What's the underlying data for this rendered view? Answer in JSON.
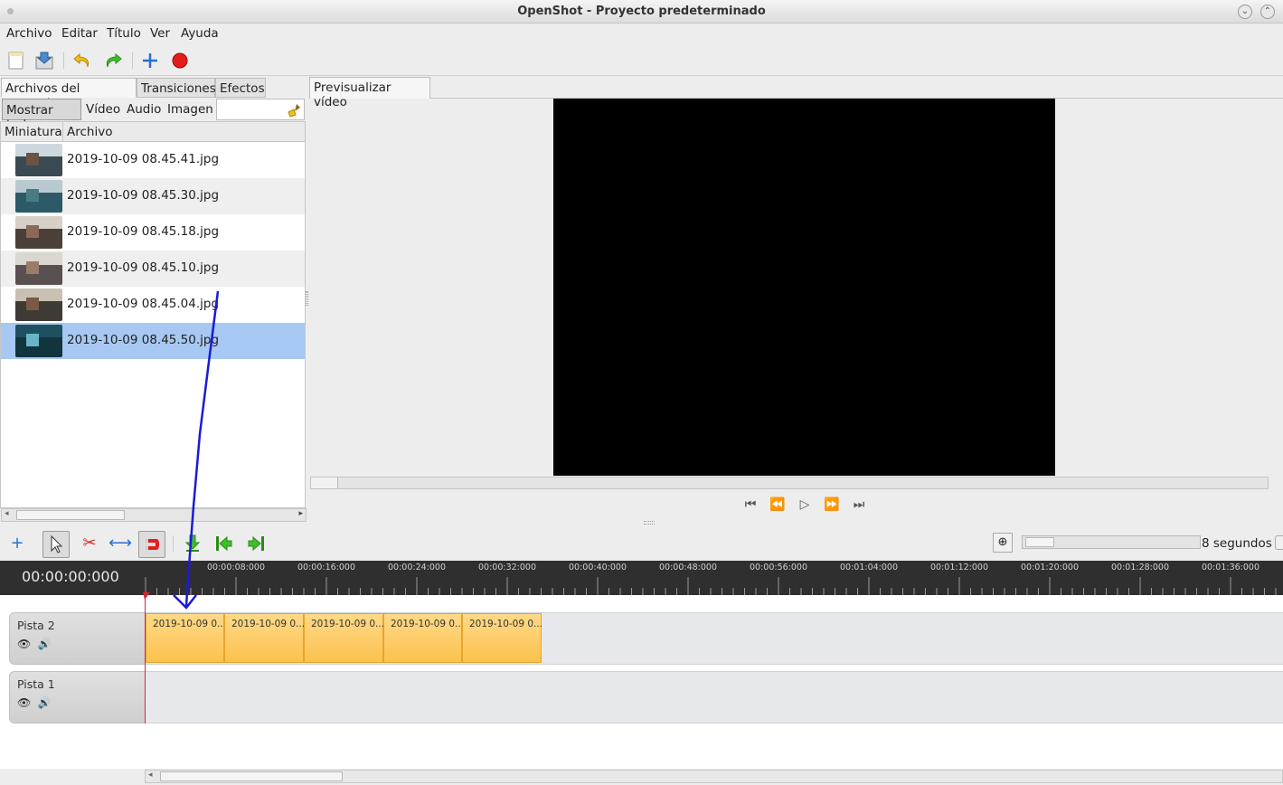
{
  "window": {
    "title": "OpenShot - Proyecto predeterminado"
  },
  "menu": [
    "Archivo",
    "Editar",
    "Título",
    "Ver",
    "Ayuda"
  ],
  "left_tabs": [
    "Archivos del proyecto",
    "Transiciones",
    "Efectos"
  ],
  "filters": [
    "Mostrar todo",
    "Vídeo",
    "Audio",
    "Imagen"
  ],
  "file_columns": [
    "Miniatura",
    "Archivo"
  ],
  "files": [
    "2019-10-09 08.45.41.jpg",
    "2019-10-09 08.45.30.jpg",
    "2019-10-09 08.45.18.jpg",
    "2019-10-09 08.45.10.jpg",
    "2019-10-09 08.45.04.jpg",
    "2019-10-09 08.45.50.jpg"
  ],
  "selected_file_index": 5,
  "preview": {
    "tab": "Previsualizar vídeo"
  },
  "timeline": {
    "zoom_label": "8 segundos",
    "timecode": "00:00:00:000",
    "ruler_labels": [
      "00:00:08:000",
      "00:00:16:000",
      "00:00:24:000",
      "00:00:32:000",
      "00:00:40:000",
      "00:00:48:000",
      "00:00:56:000",
      "00:01:04:000",
      "00:01:12:000",
      "00:01:20:000",
      "00:01:28:000",
      "00:01:36:000"
    ],
    "tracks": [
      {
        "name": "Pista 2",
        "clips": [
          "2019-10-09 0...",
          "2019-10-09 0...",
          "2019-10-09 0...",
          "2019-10-09 0...",
          "2019-10-09 0..."
        ]
      },
      {
        "name": "Pista 1",
        "clips": []
      }
    ]
  },
  "colors": {
    "selection": "#a7c8f2",
    "clip": "#fbc24d",
    "ruler": "#2f2f2f",
    "playhead": "#dd2233",
    "annotation_arrow": "#1a1adc"
  }
}
